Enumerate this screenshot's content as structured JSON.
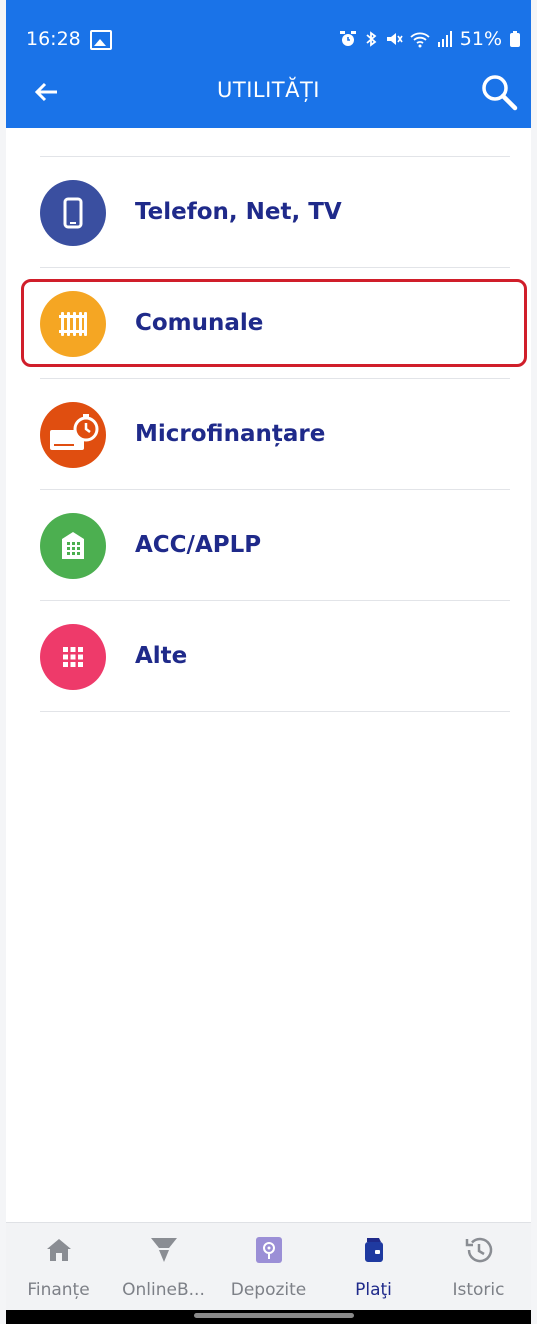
{
  "status_bar": {
    "time": "16:28",
    "battery": "51%",
    "icons": [
      "image-icon",
      "alarm-icon",
      "bluetooth-icon",
      "mute-icon",
      "wifi-icon",
      "signal-icon",
      "battery-icon"
    ]
  },
  "header": {
    "title": "UTILITĂȚI",
    "background_color": "#1a73e8"
  },
  "list": {
    "items": [
      {
        "label": "Telefon, Net, TV",
        "icon": "phone-icon",
        "color": "#3a4fa0"
      },
      {
        "label": "Comunale",
        "icon": "radiator-icon",
        "color": "#f5a623",
        "highlighted": true
      },
      {
        "label": "Microfinanțare",
        "icon": "card-clock-icon",
        "color": "#e04e10"
      },
      {
        "label": "ACC/APLP",
        "icon": "building-icon",
        "color": "#4caf50"
      },
      {
        "label": "Alte",
        "icon": "grid-icon",
        "color": "#ee3a6a"
      }
    ],
    "highlight_color": "#d01e2a"
  },
  "bottom_nav": {
    "items": [
      {
        "label": "Finanțe",
        "icon": "home-icon"
      },
      {
        "label": "OnlineB...",
        "icon": "filter-icon"
      },
      {
        "label": "Depozite",
        "icon": "safe-icon"
      },
      {
        "label": "Plaţi",
        "icon": "wallet-icon",
        "active": true
      },
      {
        "label": "Istoric",
        "icon": "history-icon"
      }
    ],
    "active_color": "#1f2a8a"
  }
}
